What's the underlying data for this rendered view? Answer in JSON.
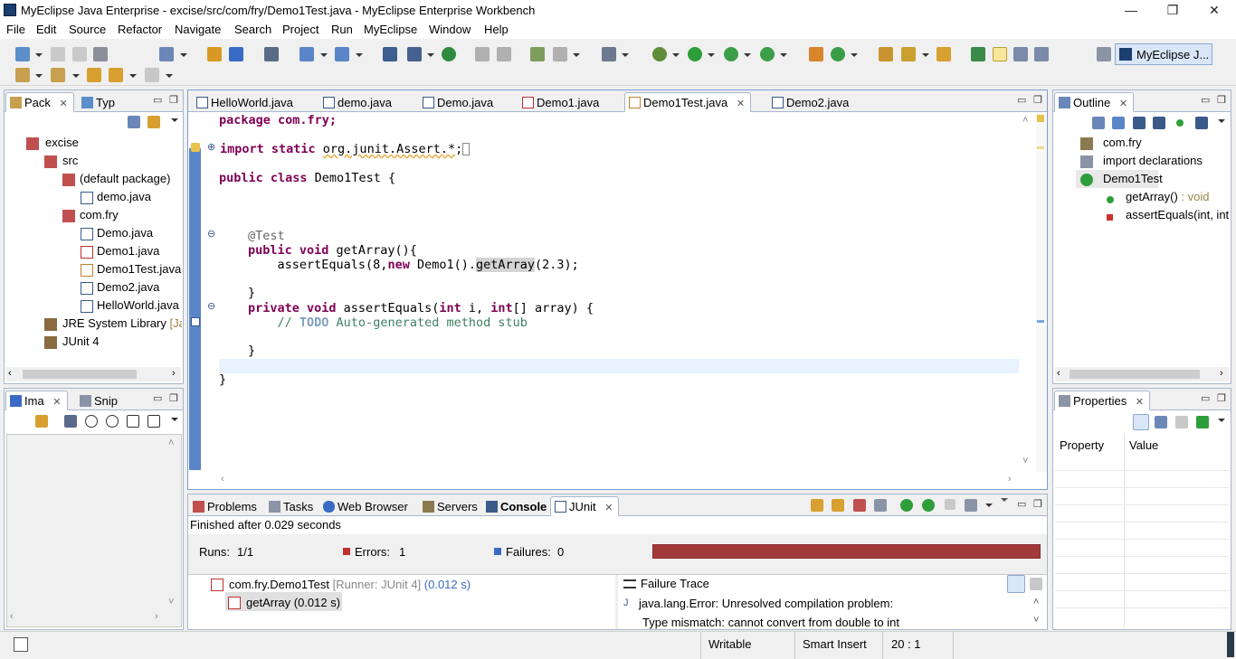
{
  "window": {
    "title": "MyEclipse Java Enterprise - excise/src/com/fry/Demo1Test.java - MyEclipse Enterprise Workbench",
    "min": "—",
    "max": "❐",
    "close": "✕"
  },
  "menu": [
    "File",
    "Edit",
    "Source",
    "Refactor",
    "Navigate",
    "Search",
    "Project",
    "Run",
    "MyEclipse",
    "Window",
    "Help"
  ],
  "perspective": {
    "label": "MyEclipse J..."
  },
  "package_view": {
    "tabs": [
      "Pack",
      "Typ"
    ],
    "tree": [
      {
        "label": "excise",
        "level": 0
      },
      {
        "label": "src",
        "level": 1
      },
      {
        "label": "(default package)",
        "level": 2
      },
      {
        "label": "demo.java",
        "level": 3
      },
      {
        "label": "com.fry",
        "level": 2
      },
      {
        "label": "Demo.java",
        "level": 3
      },
      {
        "label": "Demo1.java",
        "level": 3
      },
      {
        "label": "Demo1Test.java",
        "level": 3
      },
      {
        "label": "Demo2.java",
        "level": 3
      },
      {
        "label": "HelloWorld.java",
        "level": 3
      },
      {
        "label": "JRE System Library",
        "suffix": "[Jav",
        "level": 1
      },
      {
        "label": "JUnit 4",
        "level": 1
      }
    ]
  },
  "image_view": {
    "tabs": [
      "Ima",
      "Snip"
    ]
  },
  "editor": {
    "tabs": [
      "HelloWorld.java",
      "demo.java",
      "Demo.java",
      "Demo1.java",
      "Demo1Test.java",
      "Demo2.java"
    ],
    "active_tab": "Demo1Test.java",
    "lines": {
      "l1": "package com.fry;",
      "l2a": "import static ",
      "l2b": "org.junit.Assert.*",
      "l2c": ";",
      "l3a": "public class",
      "l3b": " Demo1Test {",
      "l4": "@Test",
      "l5a": "public void",
      "l5b": " getArray(){",
      "l6a": "    assertEquals(8,",
      "l6b": "new",
      "l6c": " Demo1().",
      "l6d": "getArray",
      "l6e": "(2.3);",
      "l7": "}",
      "l8a": "private void",
      "l8b": " assertEquals(",
      "l8c": "int",
      "l8d": " i, ",
      "l8e": "int",
      "l8f": "[] array) {",
      "l9a": "    // ",
      "l9b": "TODO",
      "l9c": " Auto-generated method stub",
      "l10": "}",
      "l11": "}"
    }
  },
  "outline": {
    "tab": "Outline",
    "items": [
      {
        "label": "com.fry"
      },
      {
        "label": "import declarations"
      },
      {
        "label": "Demo1Test"
      },
      {
        "label": "getArray()",
        "suffix": " : void"
      },
      {
        "label": "assertEquals(int, int[]"
      }
    ]
  },
  "properties": {
    "tab": "Properties",
    "col_property": "Property",
    "col_value": "Value"
  },
  "bottom": {
    "tabs": [
      "Problems",
      "Tasks",
      "Web Browser",
      "Servers",
      "Console",
      "JUnit"
    ],
    "active_tab": "JUnit",
    "finished": "Finished after 0.029 seconds",
    "runs_label": "Runs:",
    "runs": "1/1",
    "errors_label": "Errors:",
    "errors": "1",
    "failures_label": "Failures:",
    "failures": "0",
    "status_color": "#a33a3a",
    "tests": [
      {
        "name": "com.fry.Demo1Test",
        "runner": " [Runner: JUnit 4]",
        "time": " (0.012 s)"
      },
      {
        "name": "getArray (0.012 s)"
      }
    ],
    "failure_trace": {
      "title": "Failure Trace",
      "lines": [
        "java.lang.Error: Unresolved compilation problem:",
        "Type mismatch: cannot convert from double to int"
      ]
    }
  },
  "status": {
    "writable": "Writable",
    "insert": "Smart Insert",
    "position": "20 : 1"
  }
}
